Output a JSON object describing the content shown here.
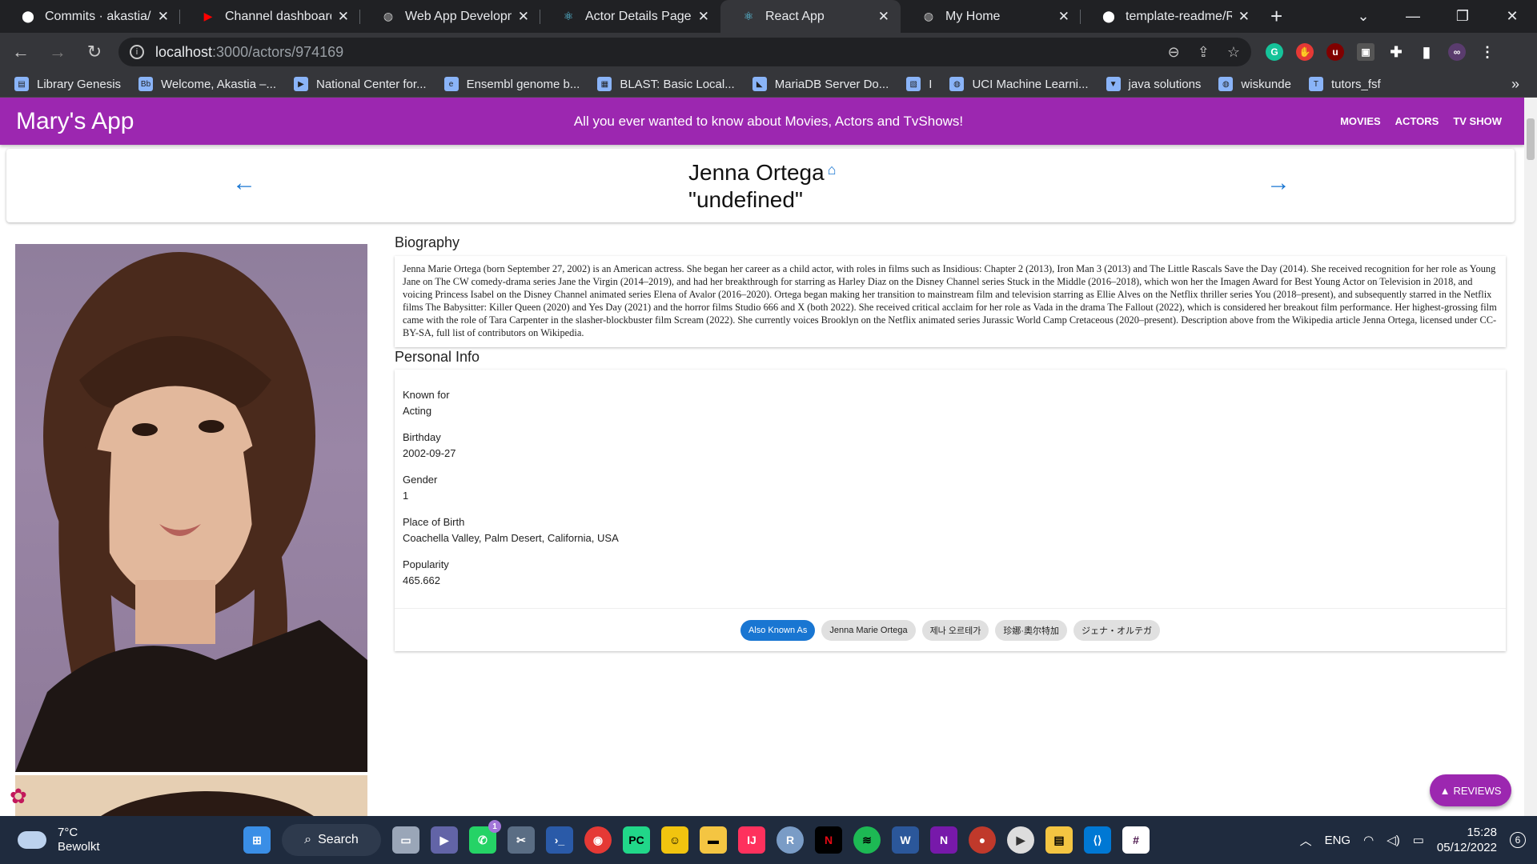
{
  "browser": {
    "tabs": [
      {
        "title": "Commits · akastia/lab",
        "icon": "github-icon",
        "active": false
      },
      {
        "title": "Channel dashboard - ",
        "icon": "youtube-icon",
        "active": false
      },
      {
        "title": "Web App Developmen",
        "icon": "globe-icon",
        "active": false
      },
      {
        "title": "Actor Details Page / A",
        "icon": "react-icon",
        "active": false
      },
      {
        "title": "React App",
        "icon": "react-icon",
        "active": true
      },
      {
        "title": "My Home",
        "icon": "globe-icon",
        "active": false
      },
      {
        "title": "template-readme/RE",
        "icon": "github-icon",
        "active": false
      }
    ],
    "url_host": "localhost",
    "url_path": ":3000/actors/974169",
    "bookmarks": [
      "Library Genesis",
      "Welcome, Akastia –...",
      "National Center for...",
      "Ensembl genome b...",
      "BLAST: Basic Local...",
      "MariaDB Server Do...",
      "I",
      "UCI Machine Learni...",
      "java solutions",
      "wiskunde",
      "tutors_fsf"
    ],
    "bookmarks_more": "»"
  },
  "app": {
    "brand": "Mary's App",
    "tagline": "All you ever wanted to know about Movies, Actors and TvShows!",
    "nav": [
      "MOVIES",
      "ACTORS",
      "TV SHOW"
    ]
  },
  "actor": {
    "name": "Jenna Ortega",
    "subtitle": "\"undefined\"",
    "biography_heading": "Biography",
    "biography": "Jenna Marie Ortega (born September 27, 2002) is an American actress. She began her career as a child actor, with roles in films such as Insidious: Chapter 2 (2013), Iron Man 3 (2013) and The Little Rascals Save the Day (2014). She received recognition for her role as Young Jane on The CW comedy-drama series Jane the Virgin (2014–2019), and had her breakthrough for starring as Harley Diaz on the Disney Channel series Stuck in the Middle (2016–2018), which won her the Imagen Award for Best Young Actor on Television in 2018, and voicing Princess Isabel on the Disney Channel animated series Elena of Avalor (2016–2020). Ortega began making her transition to mainstream film and television starring as Ellie Alves on the Netflix thriller series You (2018–present), and subsequently starred in the Netflix films The Babysitter: Killer Queen (2020) and Yes Day (2021) and the horror films Studio 666 and X (both 2022). She received critical acclaim for her role as Vada in the drama The Fallout (2022), which is considered her breakout film performance. Her highest-grossing film came with the role of Tara Carpenter in the slasher-blockbuster film Scream (2022). She currently voices Brooklyn on the Netflix animated series Jurassic World Camp Cretaceous (2020–present). Description above from the Wikipedia article Jenna Ortega, licensed under CC-BY-SA, full list of contributors on Wikipedia.",
    "personal_info_heading": "Personal Info",
    "personal_info": [
      {
        "label": "Known for",
        "value": "Acting"
      },
      {
        "label": "Birthday",
        "value": "2002-09-27"
      },
      {
        "label": "Gender",
        "value": "1"
      },
      {
        "label": "Place of Birth",
        "value": "Coachella Valley, Palm Desert, California, USA"
      },
      {
        "label": "Popularity",
        "value": "465.662"
      }
    ],
    "also_known_as_label": "Also Known As",
    "also_known_as": [
      "Jenna Marie Ortega",
      "제나 오르테가",
      "珍娜·奧尔特加",
      "ジェナ・オルテガ"
    ]
  },
  "fab_label": "REVIEWS",
  "taskbar": {
    "temperature": "7°C",
    "weather": "Bewolkt",
    "search_label": "Search",
    "whatsapp_badge": "1",
    "language": "ENG",
    "time": "15:28",
    "date": "05/12/2022",
    "notifications": "6"
  },
  "colors": {
    "appbar": "#9c27b0",
    "primary": "#1976d2"
  }
}
